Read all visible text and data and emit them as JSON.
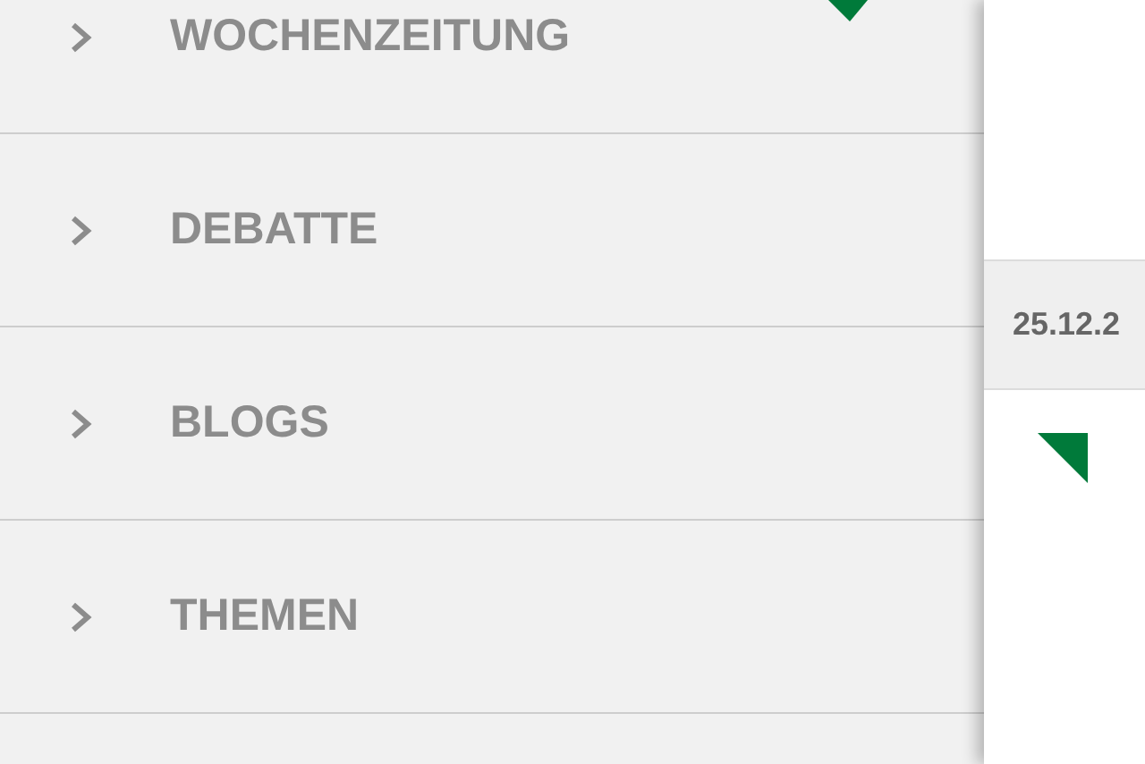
{
  "menu": {
    "items": [
      {
        "label": "WOCHENZEITUNG"
      },
      {
        "label": "DEBATTE"
      },
      {
        "label": "BLOGS"
      },
      {
        "label": "THEMEN"
      }
    ]
  },
  "feed": {
    "date": "25.12.2"
  }
}
